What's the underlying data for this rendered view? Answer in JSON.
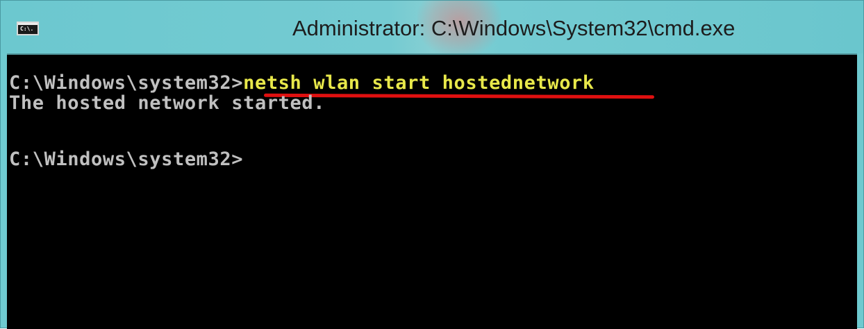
{
  "window": {
    "title": "Administrator: C:\\Windows\\System32\\cmd.exe",
    "icon_text": "C:\\.",
    "icon": "cmd-icon"
  },
  "console": {
    "line1_prompt": "C:\\Windows\\system32>",
    "line1_command": "netsh wlan start hostednetwork",
    "line2_output": "The hosted network started.",
    "line3_prompt": "C:\\Windows\\system32>"
  },
  "colors": {
    "titlebar": "#6ec9cf",
    "console_bg": "#000000",
    "console_text": "#c0c0c0",
    "command_text": "#e8e84a",
    "annotation_underline": "#e01010"
  }
}
